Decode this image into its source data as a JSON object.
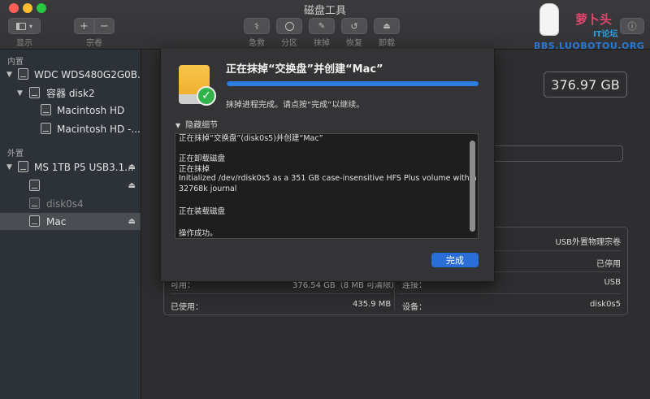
{
  "window": {
    "title": "磁盘工具"
  },
  "toolbar": {
    "display_label": "显示",
    "volume_label": "宗卷",
    "plus": "+",
    "minus": "−",
    "first_aid_label": "急救",
    "partition_label": "分区",
    "erase_label": "抹掉",
    "restore_label": "恢复",
    "unmount_label": "卸载"
  },
  "sidebar": {
    "internal_title": "内置",
    "external_title": "外置",
    "internal_items": [
      {
        "label": "WDC WDS480G2G0B..."
      },
      {
        "label": "容器 disk2"
      },
      {
        "label": "Macintosh HD"
      },
      {
        "label": "Macintosh HD -..."
      }
    ],
    "external_items": [
      {
        "label": "MS 1TB P5 USB3.1..."
      },
      {
        "label": ""
      },
      {
        "label": "disk0s4"
      },
      {
        "label": "Mac"
      }
    ]
  },
  "main": {
    "capacity": "376.97 GB",
    "info": {
      "right_top_value": "USB外置物理宗卷",
      "right_row2_value": "已停用",
      "available_label": "可用：",
      "available_value": "376.54 GB（8 MB 可清除）",
      "connection_label": "连接：",
      "connection_value": "USB",
      "used_label": "已使用：",
      "used_value": "435.9 MB",
      "device_label": "设备：",
      "device_value": "disk0s5"
    }
  },
  "dialog": {
    "title": "正在抹掉“交换盘”并创建“Mac”",
    "progress": 1.0,
    "status": "抹掉进程完成。请点按“完成”以继续。",
    "details_toggle": "隐藏细节",
    "log": [
      "正在抹掉“交换盘”(disk0s5)并创建“Mac”",
      "正在卸载磁盘",
      "正在抹掉",
      "Initialized /dev/rdisk0s5 as a 351 GB case-insensitive HFS Plus volume with a",
      "32768k journal",
      "正在装载磁盘",
      "操作成功。"
    ],
    "done_button": "完成"
  },
  "watermark": {
    "brand": "萝卜头",
    "sub": "IT论坛",
    "url": "BBS.LUOBOTOU.ORG"
  },
  "colors": {
    "accent": "#2f7de1",
    "done_button": "#2a6fd6",
    "success": "#2fb34a"
  }
}
